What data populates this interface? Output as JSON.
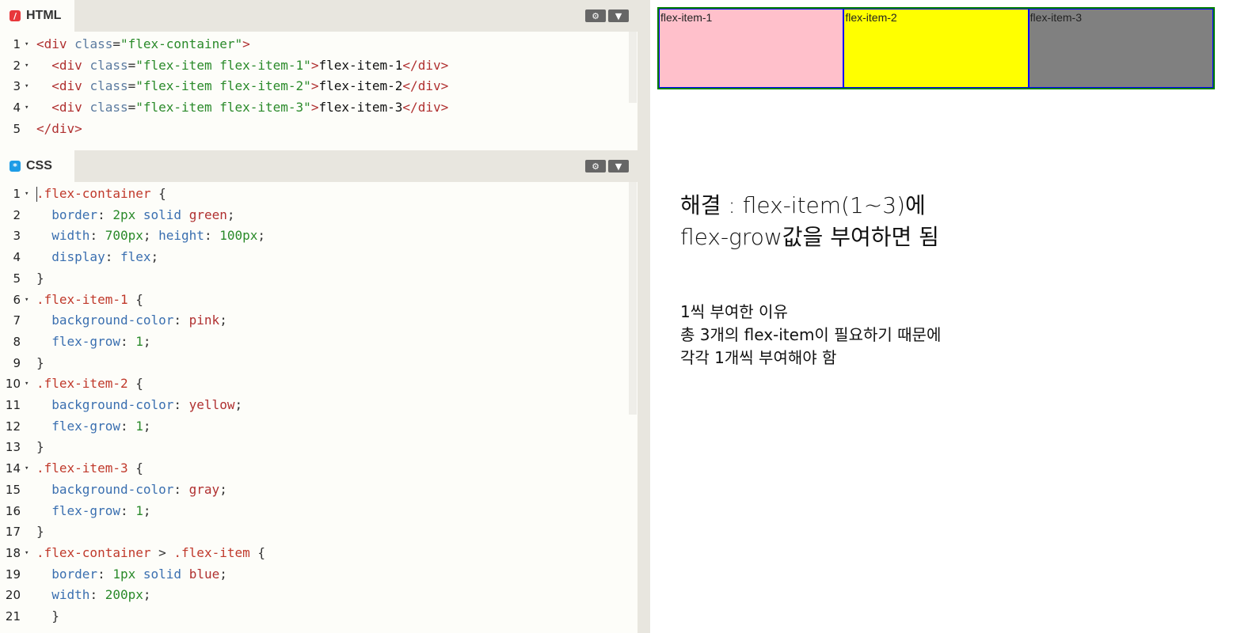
{
  "html_panel": {
    "tab_label": "HTML",
    "icon_glyph": "/",
    "icon_color": "#e8373b",
    "settings_glyph": "⚙",
    "collapse_glyph": "▼",
    "lines": [
      {
        "n": "1",
        "fold": "▾",
        "tokens": [
          [
            "t-tag",
            "<div "
          ],
          [
            "t-attr",
            "class"
          ],
          [
            "t-punc",
            "="
          ],
          [
            "t-str",
            "\"flex-container\""
          ],
          [
            "t-tag",
            ">"
          ]
        ]
      },
      {
        "n": "2",
        "fold": "▾",
        "tokens": [
          [
            "t-text",
            "  "
          ],
          [
            "t-tag",
            "<div "
          ],
          [
            "t-attr",
            "class"
          ],
          [
            "t-punc",
            "="
          ],
          [
            "t-str",
            "\"flex-item flex-item-1\""
          ],
          [
            "t-tag",
            ">"
          ],
          [
            "t-text",
            "flex-item-1"
          ],
          [
            "t-tag",
            "</div>"
          ]
        ]
      },
      {
        "n": "3",
        "fold": "▾",
        "tokens": [
          [
            "t-text",
            "  "
          ],
          [
            "t-tag",
            "<div "
          ],
          [
            "t-attr",
            "class"
          ],
          [
            "t-punc",
            "="
          ],
          [
            "t-str",
            "\"flex-item flex-item-2\""
          ],
          [
            "t-tag",
            ">"
          ],
          [
            "t-text",
            "flex-item-2"
          ],
          [
            "t-tag",
            "</div>"
          ]
        ]
      },
      {
        "n": "4",
        "fold": "▾",
        "tokens": [
          [
            "t-text",
            "  "
          ],
          [
            "t-tag",
            "<div "
          ],
          [
            "t-attr",
            "class"
          ],
          [
            "t-punc",
            "="
          ],
          [
            "t-str",
            "\"flex-item flex-item-3\""
          ],
          [
            "t-tag",
            ">"
          ],
          [
            "t-text",
            "flex-item-3"
          ],
          [
            "t-tag",
            "</div>"
          ]
        ]
      },
      {
        "n": "5",
        "fold": "",
        "tokens": [
          [
            "t-tag",
            "</div>"
          ]
        ]
      }
    ]
  },
  "css_panel": {
    "tab_label": "CSS",
    "icon_glyph": "*",
    "icon_color": "#1e9ce6",
    "settings_glyph": "⚙",
    "collapse_glyph": "▼",
    "lines": [
      {
        "n": "1",
        "fold": "▾",
        "tokens": [
          [
            "t-sel",
            ".flex-container"
          ],
          [
            "t-punc",
            " {"
          ]
        ]
      },
      {
        "n": "2",
        "fold": "",
        "tokens": [
          [
            "t-text",
            "  "
          ],
          [
            "t-prop",
            "border"
          ],
          [
            "t-punc",
            ": "
          ],
          [
            "t-num",
            "2px"
          ],
          [
            "t-punc",
            " "
          ],
          [
            "t-prop",
            "solid"
          ],
          [
            "t-punc",
            " "
          ],
          [
            "t-val",
            "green"
          ],
          [
            "t-punc",
            ";"
          ]
        ]
      },
      {
        "n": "3",
        "fold": "",
        "tokens": [
          [
            "t-text",
            "  "
          ],
          [
            "t-prop",
            "width"
          ],
          [
            "t-punc",
            ": "
          ],
          [
            "t-num",
            "700px"
          ],
          [
            "t-punc",
            "; "
          ],
          [
            "t-prop",
            "height"
          ],
          [
            "t-punc",
            ": "
          ],
          [
            "t-num",
            "100px"
          ],
          [
            "t-punc",
            ";"
          ]
        ]
      },
      {
        "n": "4",
        "fold": "",
        "tokens": [
          [
            "t-text",
            "  "
          ],
          [
            "t-prop",
            "display"
          ],
          [
            "t-punc",
            ": "
          ],
          [
            "t-prop",
            "flex"
          ],
          [
            "t-punc",
            ";"
          ]
        ]
      },
      {
        "n": "5",
        "fold": "",
        "tokens": [
          [
            "t-punc",
            "}"
          ]
        ]
      },
      {
        "n": "6",
        "fold": "▾",
        "tokens": [
          [
            "t-sel",
            ".flex-item-1"
          ],
          [
            "t-punc",
            " {"
          ]
        ]
      },
      {
        "n": "7",
        "fold": "",
        "tokens": [
          [
            "t-text",
            "  "
          ],
          [
            "t-prop",
            "background-color"
          ],
          [
            "t-punc",
            ": "
          ],
          [
            "t-val",
            "pink"
          ],
          [
            "t-punc",
            ";"
          ]
        ]
      },
      {
        "n": "8",
        "fold": "",
        "tokens": [
          [
            "t-text",
            "  "
          ],
          [
            "t-prop",
            "flex-grow"
          ],
          [
            "t-punc",
            ": "
          ],
          [
            "t-num",
            "1"
          ],
          [
            "t-punc",
            ";"
          ]
        ]
      },
      {
        "n": "9",
        "fold": "",
        "tokens": [
          [
            "t-punc",
            "}"
          ]
        ]
      },
      {
        "n": "10",
        "fold": "▾",
        "tokens": [
          [
            "t-sel",
            ".flex-item-2"
          ],
          [
            "t-punc",
            " {"
          ]
        ]
      },
      {
        "n": "11",
        "fold": "",
        "tokens": [
          [
            "t-text",
            "  "
          ],
          [
            "t-prop",
            "background-color"
          ],
          [
            "t-punc",
            ": "
          ],
          [
            "t-val",
            "yellow"
          ],
          [
            "t-punc",
            ";"
          ]
        ]
      },
      {
        "n": "12",
        "fold": "",
        "tokens": [
          [
            "t-text",
            "  "
          ],
          [
            "t-prop",
            "flex-grow"
          ],
          [
            "t-punc",
            ": "
          ],
          [
            "t-num",
            "1"
          ],
          [
            "t-punc",
            ";"
          ]
        ]
      },
      {
        "n": "13",
        "fold": "",
        "tokens": [
          [
            "t-punc",
            "}"
          ]
        ]
      },
      {
        "n": "14",
        "fold": "▾",
        "tokens": [
          [
            "t-sel",
            ".flex-item-3"
          ],
          [
            "t-punc",
            " {"
          ]
        ]
      },
      {
        "n": "15",
        "fold": "",
        "tokens": [
          [
            "t-text",
            "  "
          ],
          [
            "t-prop",
            "background-color"
          ],
          [
            "t-punc",
            ": "
          ],
          [
            "t-val",
            "gray"
          ],
          [
            "t-punc",
            ";"
          ]
        ]
      },
      {
        "n": "16",
        "fold": "",
        "tokens": [
          [
            "t-text",
            "  "
          ],
          [
            "t-prop",
            "flex-grow"
          ],
          [
            "t-punc",
            ": "
          ],
          [
            "t-num",
            "1"
          ],
          [
            "t-punc",
            ";"
          ]
        ]
      },
      {
        "n": "17",
        "fold": "",
        "tokens": [
          [
            "t-punc",
            "}"
          ]
        ]
      },
      {
        "n": "18",
        "fold": "▾",
        "tokens": [
          [
            "t-sel",
            ".flex-container"
          ],
          [
            "t-punc",
            " > "
          ],
          [
            "t-sel",
            ".flex-item"
          ],
          [
            "t-punc",
            " {"
          ]
        ]
      },
      {
        "n": "19",
        "fold": "",
        "tokens": [
          [
            "t-text",
            "  "
          ],
          [
            "t-prop",
            "border"
          ],
          [
            "t-punc",
            ": "
          ],
          [
            "t-num",
            "1px"
          ],
          [
            "t-punc",
            " "
          ],
          [
            "t-prop",
            "solid"
          ],
          [
            "t-punc",
            " "
          ],
          [
            "t-val",
            "blue"
          ],
          [
            "t-punc",
            ";"
          ]
        ]
      },
      {
        "n": "20",
        "fold": "",
        "tokens": [
          [
            "t-text",
            "  "
          ],
          [
            "t-prop",
            "width"
          ],
          [
            "t-punc",
            ": "
          ],
          [
            "t-num",
            "200px"
          ],
          [
            "t-punc",
            ";"
          ]
        ]
      },
      {
        "n": "21",
        "fold": "",
        "tokens": [
          [
            "t-text",
            "  "
          ],
          [
            "t-punc",
            "}"
          ]
        ]
      }
    ]
  },
  "preview": {
    "items": [
      {
        "label": "flex-item-1",
        "color": "#ffc0cb"
      },
      {
        "label": "flex-item-2",
        "color": "#ffff00"
      },
      {
        "label": "flex-item-3",
        "color": "#808080"
      }
    ],
    "note_title_line1": "해결 : flex-item(1~3)에",
    "note_title_line2": "flex-grow값을 부여하면 됨",
    "note_body_line1": "1씩 부여한 이유",
    "note_body_line2": "총 3개의 flex-item이 필요하기 때문에",
    "note_body_line3": "각각 1개씩 부여해야 함"
  }
}
